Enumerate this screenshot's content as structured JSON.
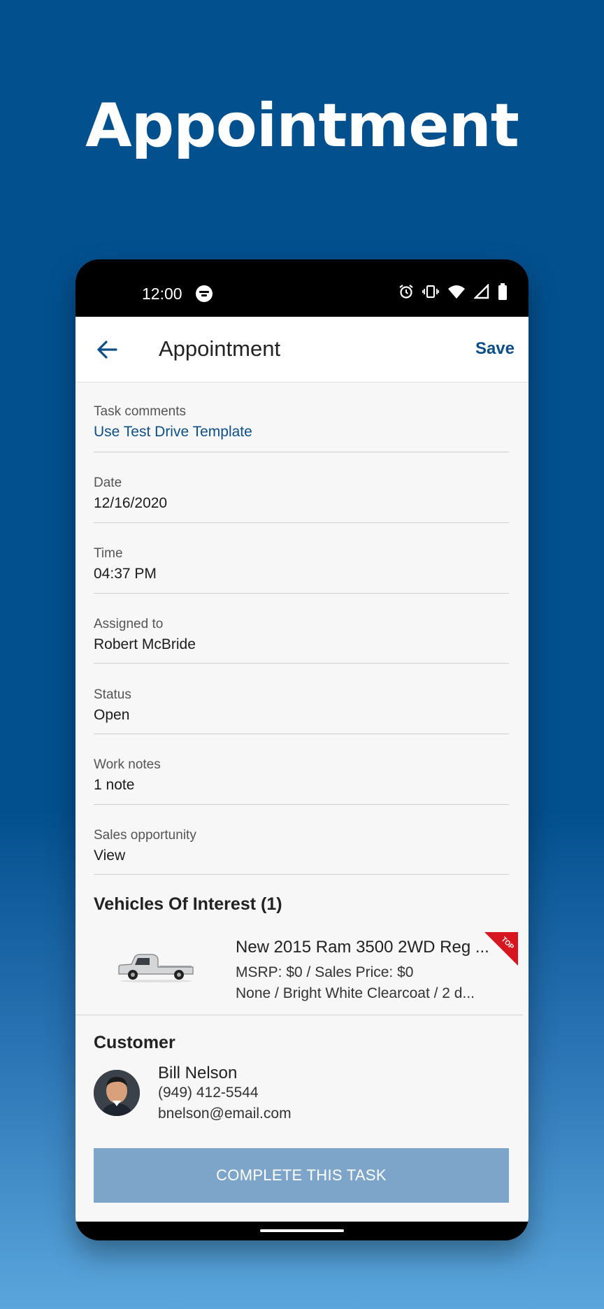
{
  "hero": {
    "title": "Appointment"
  },
  "status_bar": {
    "time": "12:00"
  },
  "app_bar": {
    "title": "Appointment",
    "save_label": "Save"
  },
  "fields": [
    {
      "label": "Task comments",
      "value": "Use Test Drive Template"
    },
    {
      "label": "Date",
      "value": "12/16/2020"
    },
    {
      "label": "Time",
      "value": "04:37 PM"
    },
    {
      "label": "Assigned to",
      "value": "Robert McBride"
    },
    {
      "label": "Status",
      "value": "Open"
    },
    {
      "label": "Work notes",
      "value": "1 note"
    },
    {
      "label": "Sales opportunity",
      "value": "View"
    }
  ],
  "vehicles": {
    "section_title": "Vehicles Of Interest (1)",
    "items": [
      {
        "title": "New 2015 Ram 3500 2WD Reg ...",
        "price_line": "MSRP: $0 / Sales Price: $0",
        "detail_line": "None / Bright White Clearcoat / 2 d...",
        "badge": "TOP"
      }
    ]
  },
  "customer": {
    "section_title": "Customer",
    "name": "Bill Nelson",
    "phone": "(949) 412-5544",
    "email": "bnelson@email.com"
  },
  "actions": {
    "complete_label": "COMPLETE THIS TASK"
  },
  "colors": {
    "brand_blue": "#03508f",
    "link": "#0d4f8b",
    "badge_red": "#d7161f",
    "button": "#7da5c9"
  }
}
